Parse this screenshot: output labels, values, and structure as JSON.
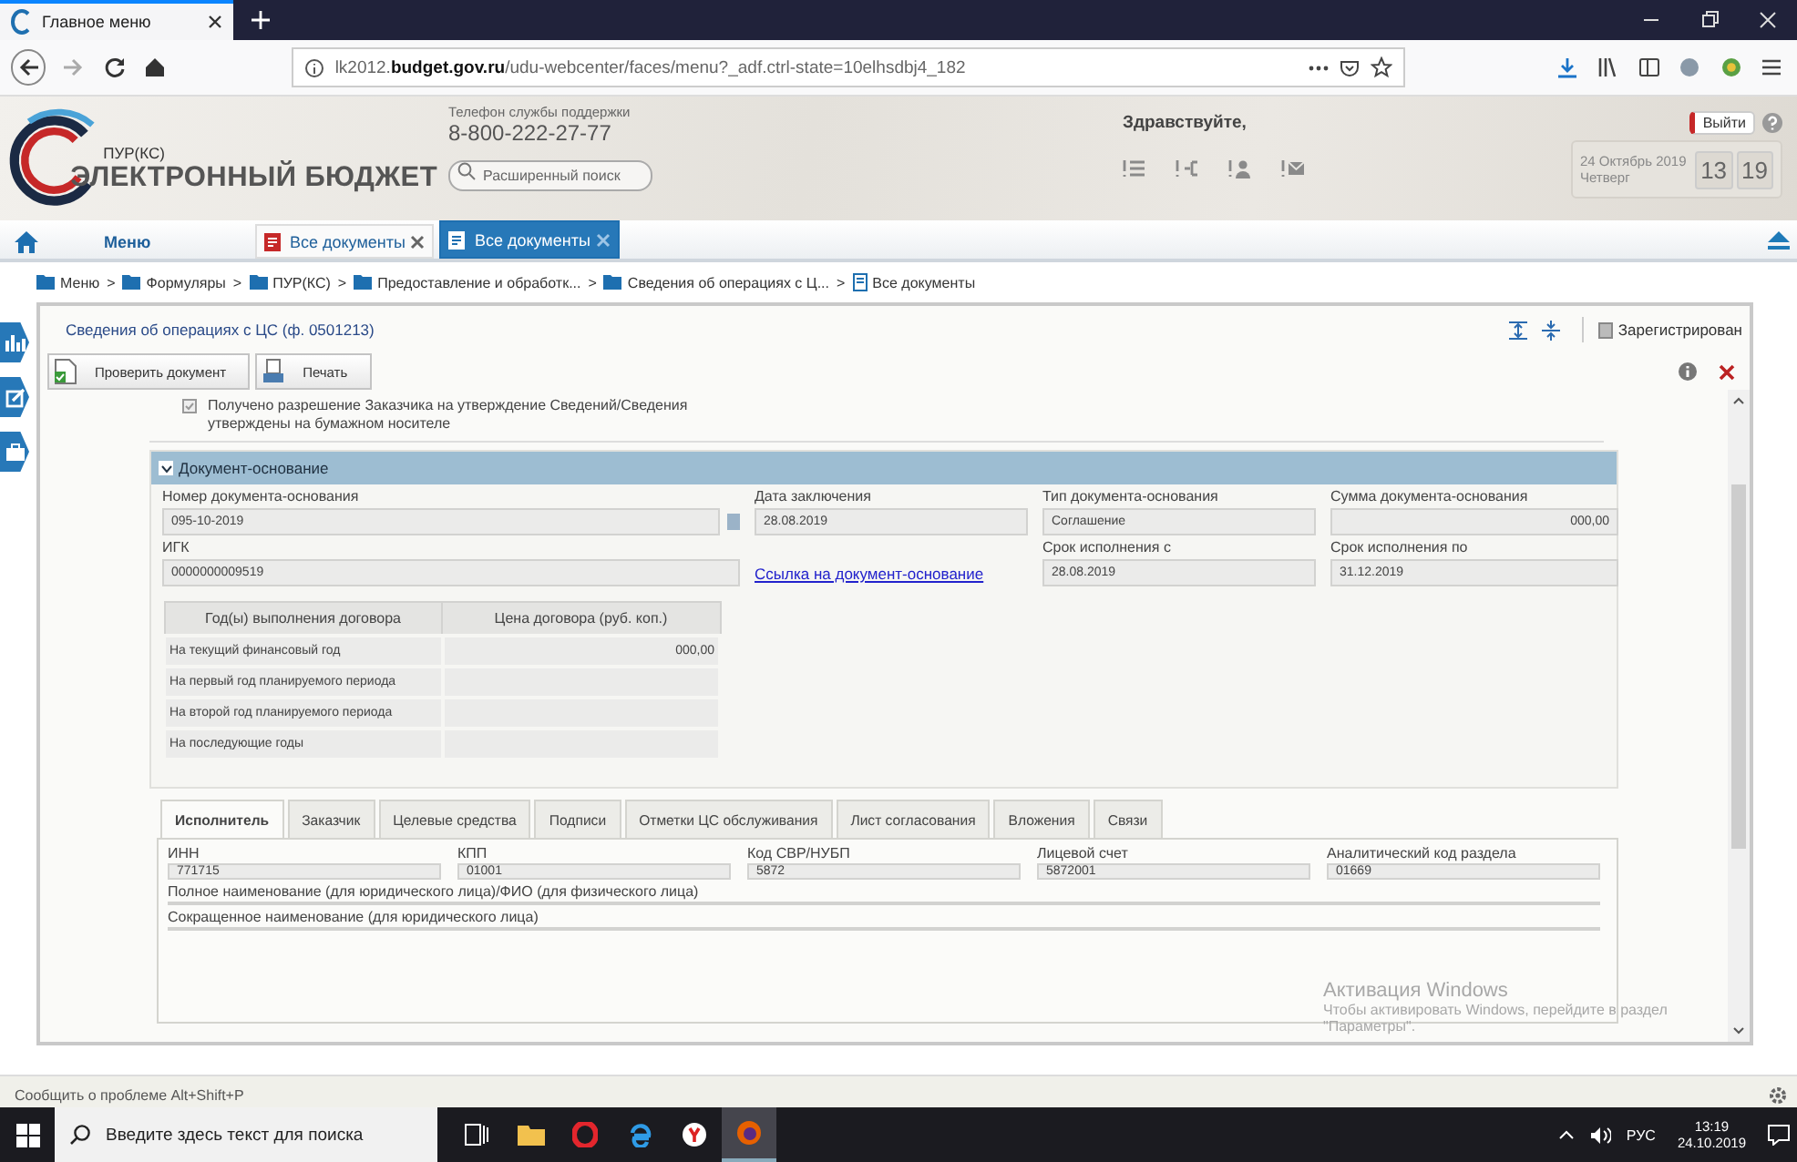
{
  "browser": {
    "tab_title": "Главное меню",
    "url_host": "lk2012.",
    "url_domain": "budget.gov.ru",
    "url_path": "/udu-webcenter/faces/menu?_adf.ctrl-state=10elhsdbj4_182"
  },
  "header": {
    "subtitle": "ПУР(КС)",
    "logo_title": "ЭЛЕКТРОННЫЙ БЮДЖЕТ",
    "support_label": "Телефон службы поддержки",
    "support_phone": "8-800-222-27-77",
    "search_placeholder": "Расширенный поиск",
    "greeting": "Здравствуйте,",
    "logout": "Выйти",
    "date": "24 Октябрь 2019",
    "weekday": "Четверг",
    "hour": "13",
    "minute": "19"
  },
  "app_tabs": [
    {
      "kind": "menu",
      "label": "Меню",
      "selected": false
    },
    {
      "kind": "doc",
      "label": "Все документы",
      "selected": false
    },
    {
      "kind": "doc",
      "label": "Все документы",
      "selected": true
    }
  ],
  "breadcrumbs": {
    "separator": ">",
    "items": [
      {
        "label": "Меню",
        "kind": "folder"
      },
      {
        "label": "Формуляры",
        "kind": "folder"
      },
      {
        "label": "ПУР(КС)",
        "kind": "folder"
      },
      {
        "label": "Предоставление и обработк...",
        "kind": "folder"
      },
      {
        "label": "Сведения об операциях с Ц...",
        "kind": "folder"
      },
      {
        "label": "Все документы",
        "kind": "page"
      }
    ]
  },
  "document": {
    "title": "Сведения об операциях с ЦС (ф. 0501213)",
    "status": "Зарегистрирован",
    "toolbar": [
      {
        "kind": "check",
        "label": "Проверить документ"
      },
      {
        "kind": "print",
        "label": "Печать"
      }
    ],
    "note": "Получено разрешение Заказчика на утверждение Сведений/Сведения утверждены на бумажном носителе",
    "section": {
      "title": "Документ-основание",
      "expanded": true,
      "fields": [
        {
          "label": "Номер документа-основания",
          "value": "095-10-2019",
          "kind": "wide"
        },
        {
          "label": "Дата заключения",
          "value": "28.08.2019",
          "kind": "text"
        },
        {
          "label": "Тип документа-основания",
          "value": "Соглашение",
          "kind": "text"
        },
        {
          "label": "Сумма документа-основания",
          "value": "000,00",
          "kind": "amount"
        },
        {
          "label": "ИГК",
          "value": "0000000009519",
          "kind": "wide"
        },
        {
          "label": "Ссылка на документ-основание",
          "kind": "link"
        },
        {
          "label": "Срок исполнения с",
          "value": "28.08.2019",
          "kind": "text"
        },
        {
          "label": "Срок исполнения по",
          "value": "31.12.2019",
          "kind": "text"
        }
      ],
      "table": {
        "columns": [
          "Год(ы) выполнения договора",
          "Цена договора (руб. коп.)"
        ],
        "rows": [
          [
            "На текущий финансовый год",
            "000,00"
          ],
          [
            "На первый год планируемого периода",
            ""
          ],
          [
            "На второй год планируемого периода",
            ""
          ],
          [
            "На последующие годы",
            ""
          ]
        ]
      }
    },
    "tabs": [
      {
        "label": "Исполнитель",
        "selected": true
      },
      {
        "label": "Заказчик",
        "selected": false
      },
      {
        "label": "Целевые средства",
        "selected": false
      },
      {
        "label": "Подписи",
        "selected": false
      },
      {
        "label": "Отметки ЦС обслуживания",
        "selected": false
      },
      {
        "label": "Лист согласования",
        "selected": false
      },
      {
        "label": "Вложения",
        "selected": false
      },
      {
        "label": "Связи",
        "selected": false
      }
    ],
    "tab_fields": [
      {
        "label": "ИНН",
        "value": "771715",
        "kind": "short"
      },
      {
        "label": "КПП",
        "value": "01001",
        "kind": "short"
      },
      {
        "label": "Код СВР/НУБП",
        "value": "5872",
        "kind": "short"
      },
      {
        "label": "Лицевой счет",
        "value": "5872001",
        "kind": "short"
      },
      {
        "label": "Аналитический код раздела",
        "value": "01669",
        "kind": "short"
      },
      {
        "label": "Полное наименование (для юридического лица)/ФИО (для физического лица)",
        "kind": "full"
      },
      {
        "label": "Сокращенное наименование (для юридического лица)",
        "kind": "full"
      }
    ]
  },
  "activation": {
    "title": "Активация Windows",
    "text": "Чтобы активировать Windows, перейдите в раздел",
    "text_2": "\"Параметры\"."
  },
  "status_bar": "Сообщить о проблеме Alt+Shift+P",
  "taskbar": {
    "search_placeholder": "Введите здесь текст для поиска",
    "language": "РУС",
    "time": "13:19",
    "date": "24.10.2019"
  }
}
